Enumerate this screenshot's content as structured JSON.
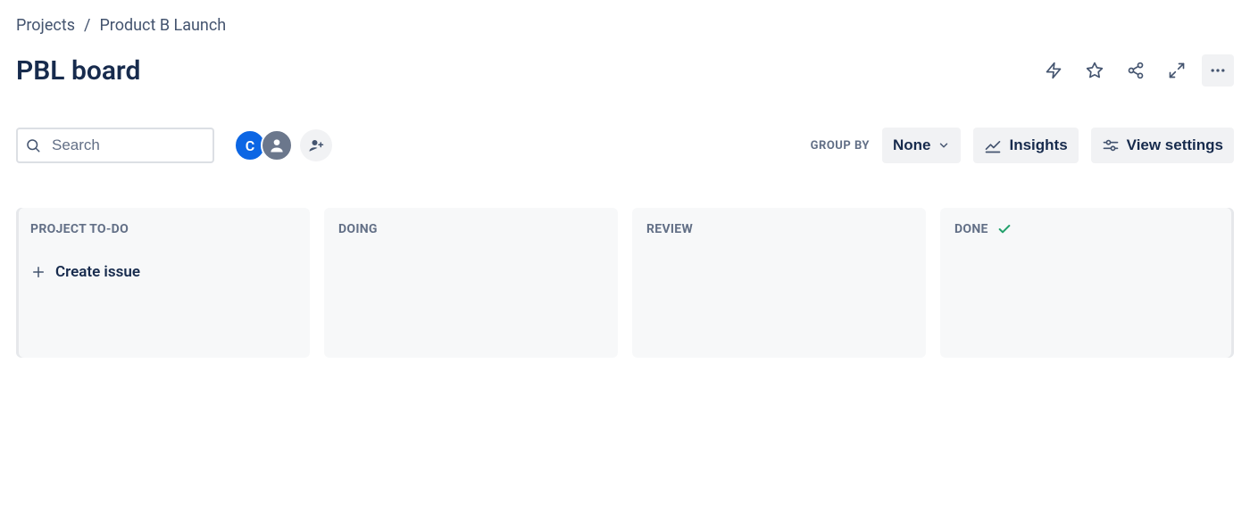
{
  "breadcrumb": {
    "root": "Projects",
    "project": "Product B Launch"
  },
  "title": "PBL board",
  "search": {
    "placeholder": "Search"
  },
  "avatars": {
    "user_initial": "C"
  },
  "toolbar": {
    "groupby_label": "GROUP BY",
    "groupby_value": "None",
    "insights_label": "Insights",
    "view_settings_label": "View settings"
  },
  "columns": {
    "c0": "PROJECT TO-DO",
    "c1": "DOING",
    "c2": "REVIEW",
    "c3": "DONE"
  },
  "actions": {
    "create_issue": "Create issue"
  }
}
